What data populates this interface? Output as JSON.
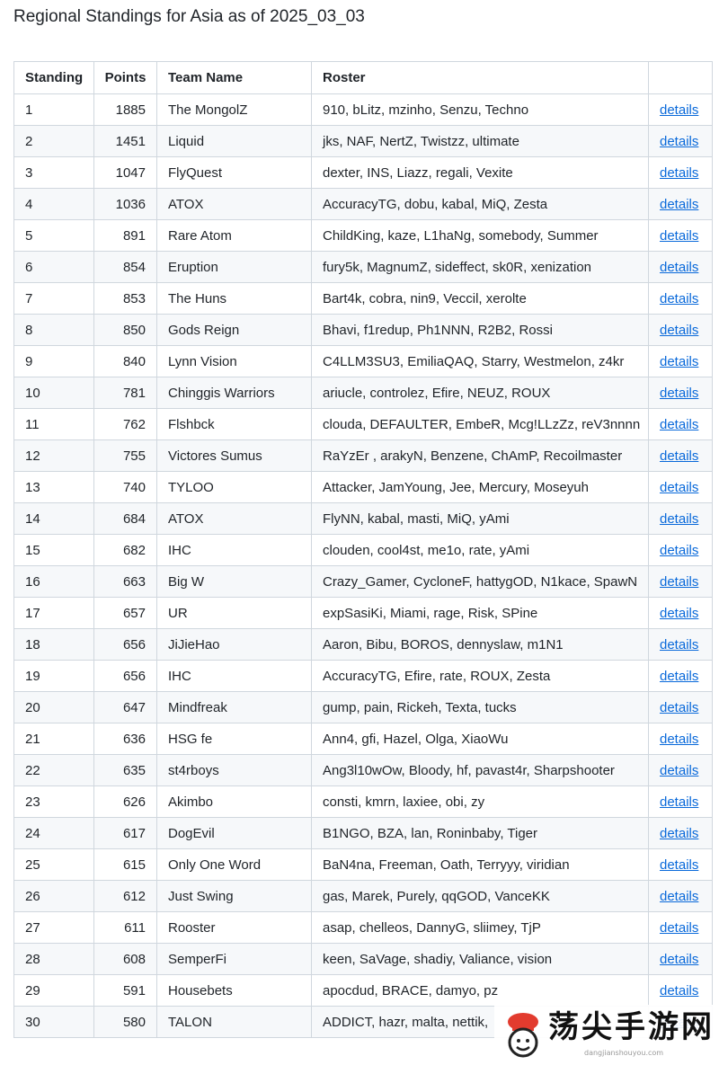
{
  "page": {
    "title": "Regional Standings for Asia as of 2025_03_03"
  },
  "table": {
    "headers": {
      "standing": "Standing",
      "points": "Points",
      "team": "Team Name",
      "roster": "Roster",
      "details": ""
    },
    "link_label": "details",
    "rows": [
      {
        "standing": "1",
        "points": "1885",
        "team": "The MongolZ",
        "roster": "910, bLitz, mzinho, Senzu, Techno"
      },
      {
        "standing": "2",
        "points": "1451",
        "team": "Liquid",
        "roster": "jks, NAF, NertZ, Twistzz, ultimate"
      },
      {
        "standing": "3",
        "points": "1047",
        "team": "FlyQuest",
        "roster": "dexter, INS, Liazz, regali, Vexite"
      },
      {
        "standing": "4",
        "points": "1036",
        "team": "ATOX",
        "roster": "AccuracyTG, dobu, kabal, MiQ, Zesta"
      },
      {
        "standing": "5",
        "points": "891",
        "team": "Rare Atom",
        "roster": "ChildKing, kaze, L1haNg, somebody, Summer"
      },
      {
        "standing": "6",
        "points": "854",
        "team": "Eruption",
        "roster": "fury5k, MagnumZ, sideffect, sk0R, xenization"
      },
      {
        "standing": "7",
        "points": "853",
        "team": "The Huns",
        "roster": "Bart4k, cobra, nin9, Veccil, xerolte"
      },
      {
        "standing": "8",
        "points": "850",
        "team": "Gods Reign",
        "roster": "Bhavi, f1redup, Ph1NNN, R2B2, Rossi"
      },
      {
        "standing": "9",
        "points": "840",
        "team": "Lynn Vision",
        "roster": "C4LLM3SU3, EmiliaQAQ, Starry, Westmelon, z4kr"
      },
      {
        "standing": "10",
        "points": "781",
        "team": "Chinggis Warriors",
        "roster": "ariucle, controlez, Efire, NEUZ, ROUX"
      },
      {
        "standing": "11",
        "points": "762",
        "team": "Flshbck",
        "roster": "clouda, DEFAULTER, EmbeR, Mcg!LLzZz, reV3nnnn"
      },
      {
        "standing": "12",
        "points": "755",
        "team": "Victores Sumus",
        "roster": "RaYzEr , arakyN, Benzene, ChAmP, Recoilmaster"
      },
      {
        "standing": "13",
        "points": "740",
        "team": "TYLOO",
        "roster": "Attacker, JamYoung, Jee, Mercury, Moseyuh"
      },
      {
        "standing": "14",
        "points": "684",
        "team": "ATOX",
        "roster": "FlyNN, kabal, masti, MiQ, yAmi"
      },
      {
        "standing": "15",
        "points": "682",
        "team": "IHC",
        "roster": "clouden, cool4st, me1o, rate, yAmi"
      },
      {
        "standing": "16",
        "points": "663",
        "team": "Big W",
        "roster": "Crazy_Gamer, CycloneF, hattygOD, N1kace, SpawN"
      },
      {
        "standing": "17",
        "points": "657",
        "team": "UR",
        "roster": "expSasiKi, Miami, rage, Risk, SPine"
      },
      {
        "standing": "18",
        "points": "656",
        "team": "JiJieHao",
        "roster": "Aaron, Bibu, BOROS, dennyslaw, m1N1"
      },
      {
        "standing": "19",
        "points": "656",
        "team": "IHC",
        "roster": "AccuracyTG, Efire, rate, ROUX, Zesta"
      },
      {
        "standing": "20",
        "points": "647",
        "team": "Mindfreak",
        "roster": "gump, pain, Rickeh, Texta, tucks"
      },
      {
        "standing": "21",
        "points": "636",
        "team": "HSG fe",
        "roster": "Ann4, gfi, Hazel, Olga, XiaoWu"
      },
      {
        "standing": "22",
        "points": "635",
        "team": "st4rboys",
        "roster": "Ang3l10wOw, Bloody, hf, pavast4r, Sharpshooter"
      },
      {
        "standing": "23",
        "points": "626",
        "team": "Akimbo",
        "roster": "consti, kmrn, laxiee, obi, zy"
      },
      {
        "standing": "24",
        "points": "617",
        "team": "DogEvil",
        "roster": "B1NGO, BZA, lan, Roninbaby, Tiger"
      },
      {
        "standing": "25",
        "points": "615",
        "team": "Only One Word",
        "roster": "BaN4na, Freeman, Oath, Terryyy, viridian"
      },
      {
        "standing": "26",
        "points": "612",
        "team": "Just Swing",
        "roster": "gas, Marek, Purely, qqGOD, VanceKK"
      },
      {
        "standing": "27",
        "points": "611",
        "team": "Rooster",
        "roster": "asap, chelleos, DannyG, sliimey, TjP"
      },
      {
        "standing": "28",
        "points": "608",
        "team": "SemperFi",
        "roster": "keen, SaVage, shadiy, Valiance, vision"
      },
      {
        "standing": "29",
        "points": "591",
        "team": "Housebets",
        "roster": "apocdud, BRACE, damyo, pz"
      },
      {
        "standing": "30",
        "points": "580",
        "team": "TALON",
        "roster": "ADDICT, hazr, malta, nettik,"
      }
    ]
  },
  "watermark": {
    "text": "荡尖手游网",
    "subtext": "dangjianshouyou.com",
    "icon": "chef-logo-icon"
  }
}
